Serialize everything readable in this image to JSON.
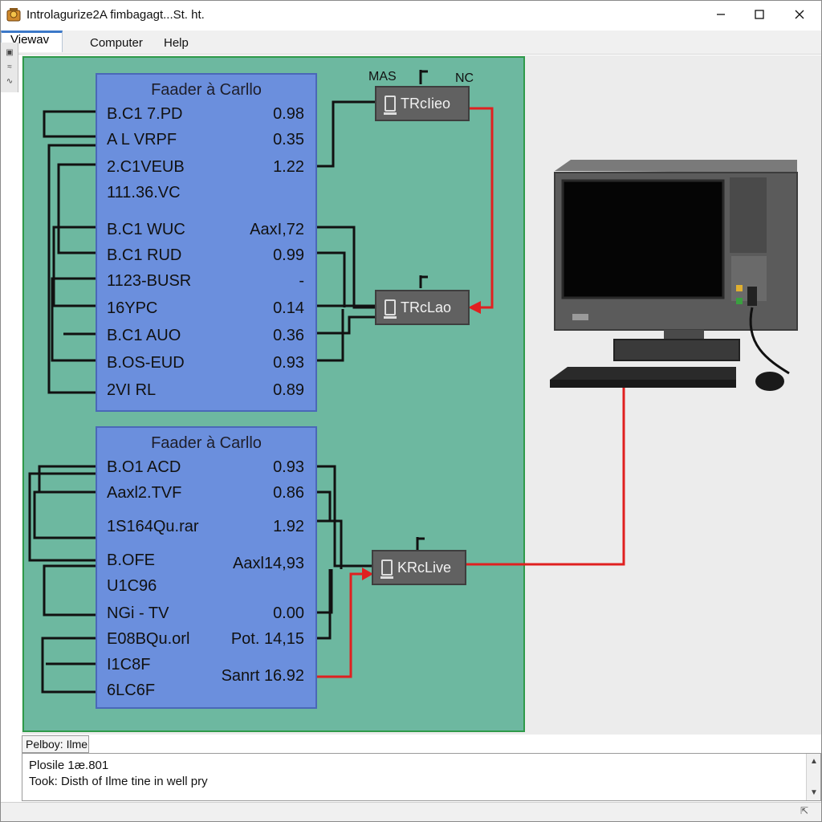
{
  "window": {
    "title": "Introlagurize2A fimbagagt...St. ht."
  },
  "menu": {
    "items": [
      "Viewav",
      "Computer",
      "Help"
    ]
  },
  "panels": [
    {
      "title": "Faader à Carllo",
      "rows": [
        {
          "name": "B.C1 7.PD",
          "value": "0.98"
        },
        {
          "name": "A L VRPF",
          "value": "0.35"
        },
        {
          "name": "2.C1VEUB",
          "value": "1.22"
        },
        {
          "name": "111.36.VC",
          "value": ""
        },
        {
          "name": "B.C1 WUC",
          "value": "AaxI,72"
        },
        {
          "name": "B.C1 RUD",
          "value": "0.99"
        },
        {
          "name": "1123-BUSR",
          "value": "-"
        },
        {
          "name": "16YPC",
          "value": "0.14"
        },
        {
          "name": "B.C1 AUO",
          "value": "0.36"
        },
        {
          "name": "B.OS-EUD",
          "value": "0.93"
        },
        {
          "name": "2VI RL",
          "value": "0.89"
        }
      ]
    },
    {
      "title": "Faader à Carllo",
      "rows": [
        {
          "name": "B.O1 ACD",
          "value": "0.93"
        },
        {
          "name": "Aaxl2.TVF",
          "value": "0.86"
        },
        {
          "name": "1S164Qu.rar",
          "value": "1.92"
        },
        {
          "name": "B.OFE",
          "value": "Aaxl14,93"
        },
        {
          "name": "U1C96",
          "value": ""
        },
        {
          "name": "NGi - TV",
          "value": "0.00"
        },
        {
          "name": "E08BQu.orl",
          "value": "Pot. 14,15"
        },
        {
          "name": "I1C8F",
          "value": ""
        },
        {
          "name": "6LC6F",
          "value": "Sanrt 16.92"
        }
      ]
    }
  ],
  "nodes": [
    {
      "label": "TRcIieo"
    },
    {
      "label": "TRcLao"
    },
    {
      "label": "KRcLive"
    }
  ],
  "antenna_labels": {
    "left": "MAS",
    "right": "NC"
  },
  "status": {
    "tab_label": "Pelboy: Ilme",
    "lines": [
      "Plosile 1æ.801",
      "Took: Disth of Ilme tine in well pry"
    ]
  },
  "colors": {
    "diagram_background": "#6db8a0",
    "panel_fill": "#6b8fdd",
    "node_fill": "#616161",
    "red_link": "#e02020",
    "black_link": "#111111"
  },
  "icons": {
    "app": "app-icon",
    "minimize": "minimize-icon",
    "maximize": "maximize-icon",
    "close": "close-icon",
    "computer": "desktop-computer-icon",
    "node": "node-device-icon"
  }
}
